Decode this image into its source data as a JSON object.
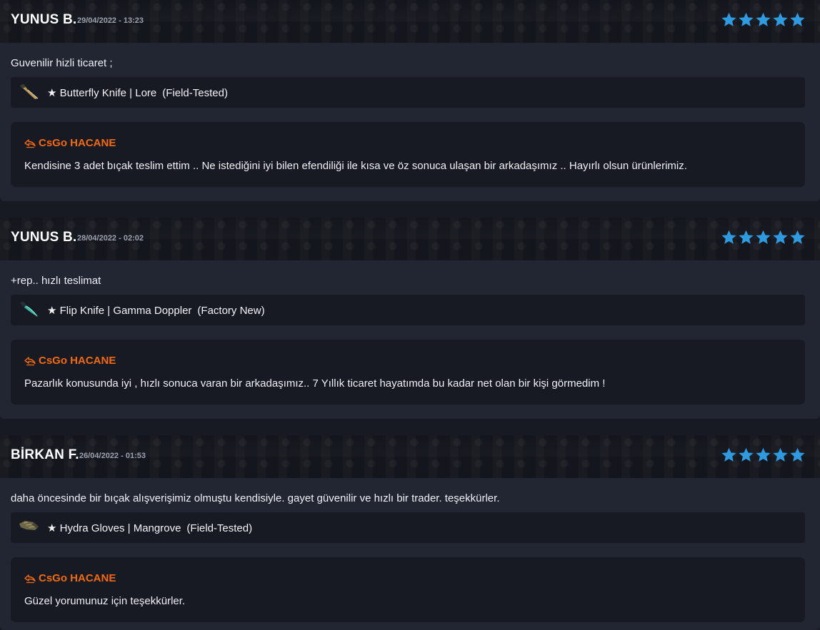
{
  "colors": {
    "star": "#2e9be0",
    "reply_accent": "#f26a10",
    "card_bg": "#222633",
    "box_bg": "#171a22"
  },
  "reviews": [
    {
      "user": "YUNUS B.",
      "date": "29/04/2022 - 13:23",
      "rating": 5,
      "comment": "Guvenilir hizli ticaret ;",
      "item": {
        "icon": "butterfly-knife-icon",
        "name": "★ Butterfly Knife | Lore",
        "wear": "(Field-Tested)"
      },
      "reply": {
        "icon": "reply-arrow-icon",
        "author": "CsGo HACANE",
        "text": "Kendisine 3 adet bıçak teslim ettim .. Ne istediğini iyi bilen efendiliği ile kısa ve öz sonuca ulaşan bir arkadaşımız .. Hayırlı olsun ürünlerimiz."
      }
    },
    {
      "user": "YUNUS B.",
      "date": "28/04/2022 - 02:02",
      "rating": 5,
      "comment": "+rep.. hızlı teslimat",
      "item": {
        "icon": "flip-knife-icon",
        "name": "★ Flip Knife | Gamma Doppler",
        "wear": "(Factory New)"
      },
      "reply": {
        "icon": "reply-arrow-icon",
        "author": "CsGo HACANE",
        "text": "Pazarlık konusunda iyi , hızlı sonuca varan bir arkadaşımız.. 7 Yıllık ticaret hayatımda bu kadar net olan bir kişi görmedim !"
      }
    },
    {
      "user": "BİRKAN F.",
      "date": "26/04/2022 - 01:53",
      "rating": 5,
      "comment": "daha öncesinde bir bıçak alışverişimiz olmuştu kendisiyle. gayet güvenilir ve hızlı bir trader. teşekkürler.",
      "item": {
        "icon": "gloves-icon",
        "name": "★ Hydra Gloves | Mangrove",
        "wear": "(Field-Tested)"
      },
      "reply": {
        "icon": "reply-arrow-icon",
        "author": "CsGo HACANE",
        "text": "Güzel yorumunuz için teşekkürler."
      }
    }
  ]
}
